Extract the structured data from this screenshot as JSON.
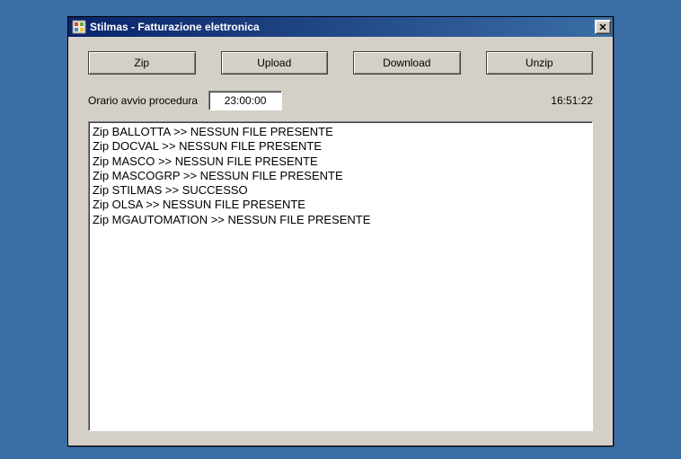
{
  "window": {
    "title": "Stilmas - Fatturazione elettronica"
  },
  "buttons": {
    "zip": "Zip",
    "upload": "Upload",
    "download": "Download",
    "unzip": "Unzip"
  },
  "schedule": {
    "label": "Orario avvio procedura",
    "time": "23:00:00"
  },
  "clock": "16:51:22",
  "log": [
    "Zip BALLOTTA >> NESSUN FILE PRESENTE",
    "Zip DOCVAL >> NESSUN FILE PRESENTE",
    "Zip MASCO >> NESSUN FILE PRESENTE",
    "Zip MASCOGRP >> NESSUN FILE PRESENTE",
    "Zip STILMAS >> SUCCESSO",
    "Zip OLSA >> NESSUN FILE PRESENTE",
    "Zip MGAUTOMATION >> NESSUN FILE PRESENTE"
  ]
}
